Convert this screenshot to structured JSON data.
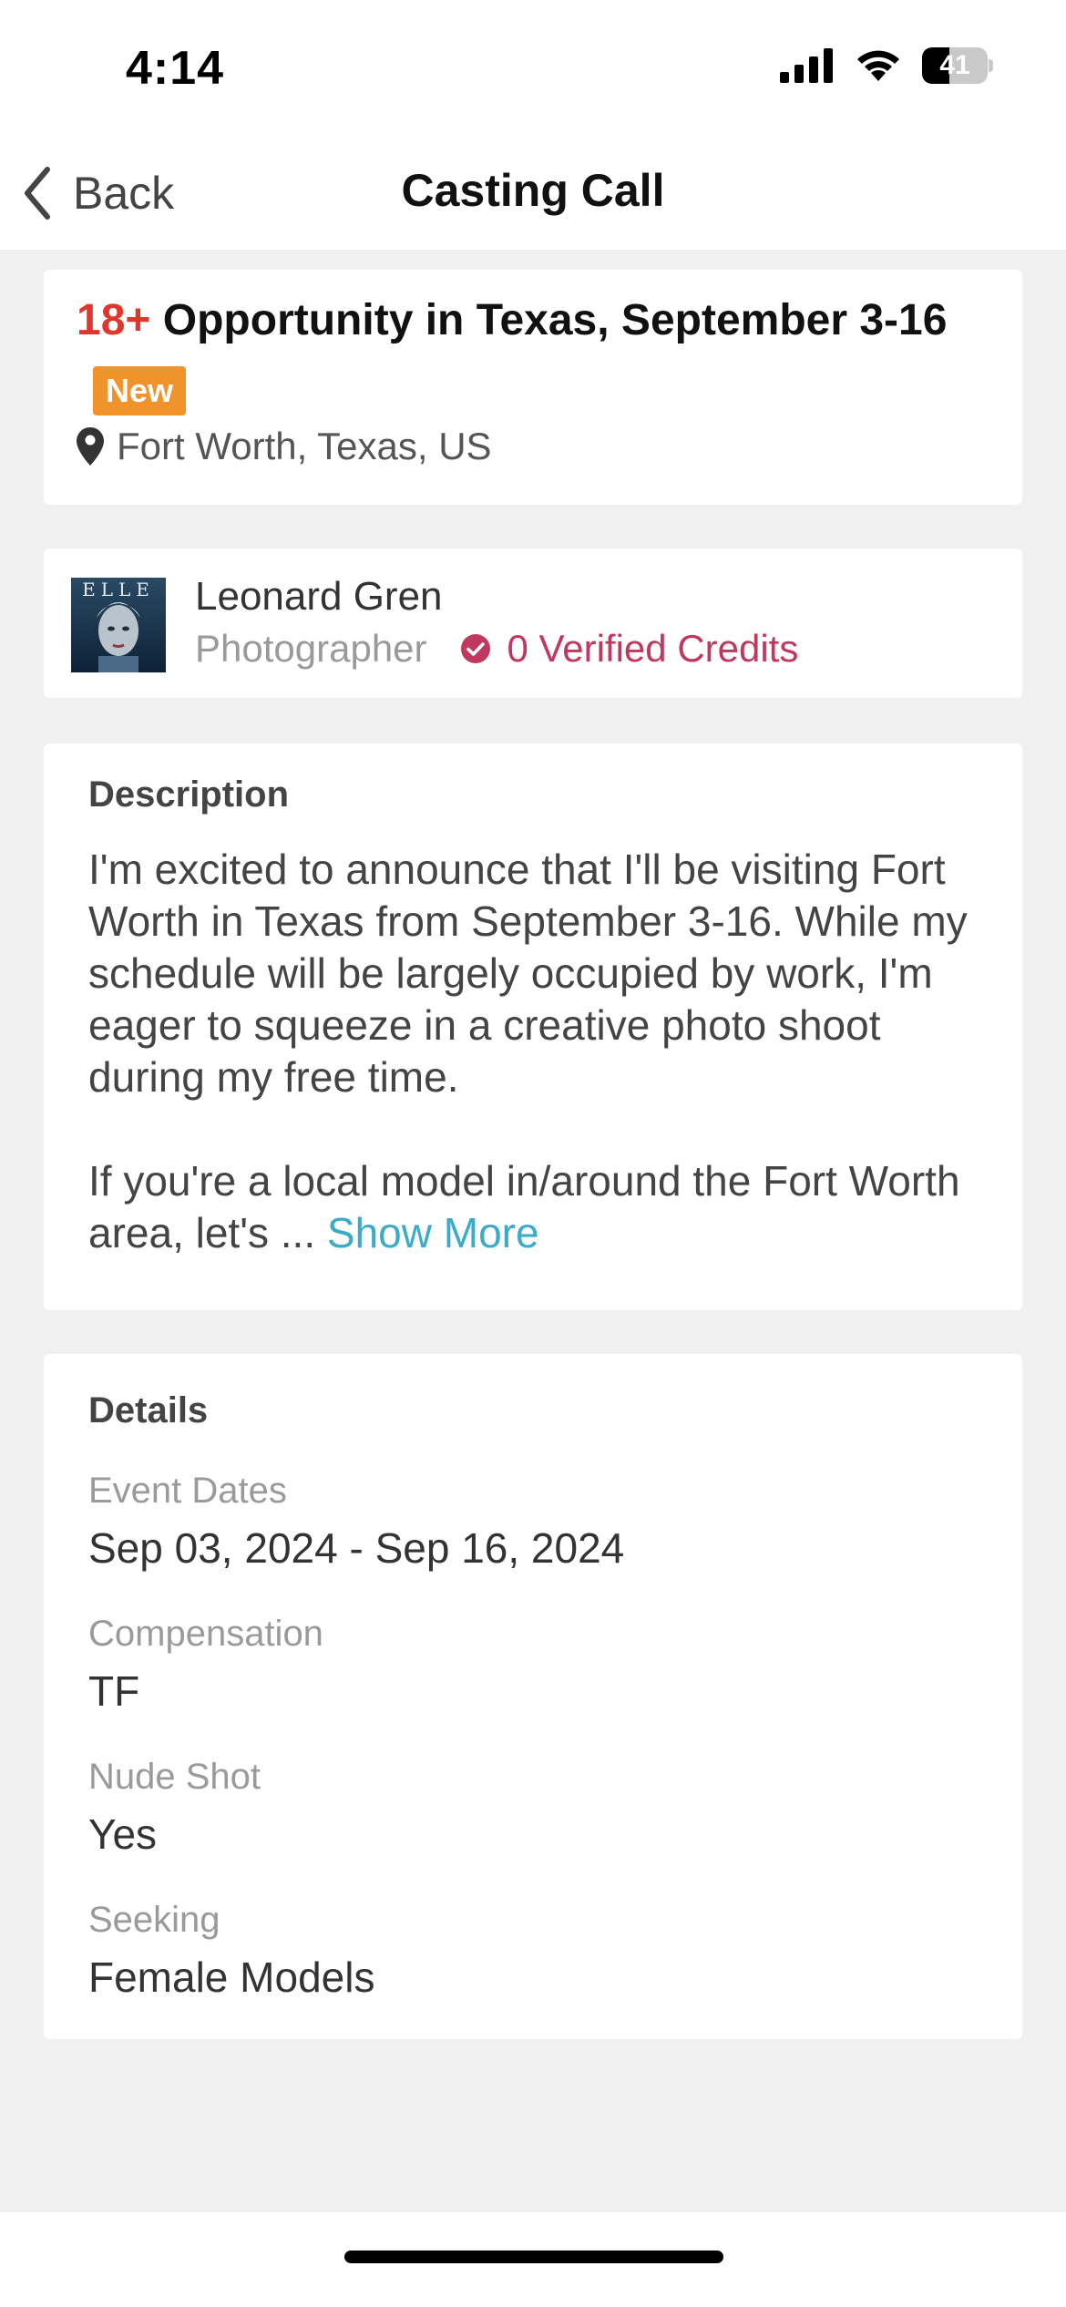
{
  "status_bar": {
    "time": "4:14",
    "battery_level": "41",
    "battery_fraction": 0.41
  },
  "nav": {
    "back_label": "Back",
    "title": "Casting Call"
  },
  "listing": {
    "age_tag": "18+",
    "title": "Opportunity in Texas, September 3-16",
    "badge": "New",
    "badge_color": "#f0932b",
    "location": "Fort Worth, Texas, US"
  },
  "author": {
    "name": "Leonard Gren",
    "role": "Photographer",
    "verified_credits": "0 Verified Credits",
    "verified_color": "#c0375f",
    "avatar_label": "ELLE"
  },
  "description": {
    "heading": "Description",
    "paragraph_1": "I'm excited to announce that I'll be visiting Fort Worth in Texas from September 3-16. While my schedule will be largely occupied by work, I'm eager to squeeze in a creative photo shoot during my free time.",
    "paragraph_2": "If you're a local model in/around the Fort Worth area, let's ...",
    "show_more": "Show More",
    "link_color": "#3cabc8"
  },
  "details": {
    "heading": "Details",
    "items": [
      {
        "label": "Event Dates",
        "value": "Sep 03, 2024 - Sep 16, 2024"
      },
      {
        "label": "Compensation",
        "value": "TF"
      },
      {
        "label": "Nude Shot",
        "value": "Yes"
      },
      {
        "label": "Seeking",
        "value": "Female Models"
      }
    ]
  }
}
